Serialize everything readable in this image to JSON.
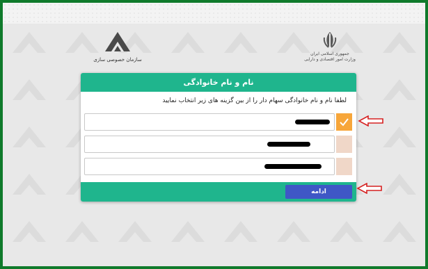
{
  "header": {
    "left_logo_text": "سازمان خصوصی سازی",
    "right_logo_line1": "جمهوری اسلامی ایران",
    "right_logo_line2": "وزارت امور اقتصادی و دارایی"
  },
  "dialog": {
    "title": "نام و نام خانوادگی",
    "instruction": "لطفا نام و نام خانوادگی سهام دار را از بین گزینه های زیر انتخاب نمایید",
    "options": [
      {
        "selected": true
      },
      {
        "selected": false
      },
      {
        "selected": false
      }
    ],
    "continue_label": "ادامه"
  },
  "colors": {
    "accent": "#1fb58d",
    "button": "#3f57c6",
    "selected_check": "#f7a63a",
    "unselected_check": "#f0d7c8",
    "annotation_arrow": "#d62020",
    "border": "#0f7a2b"
  }
}
